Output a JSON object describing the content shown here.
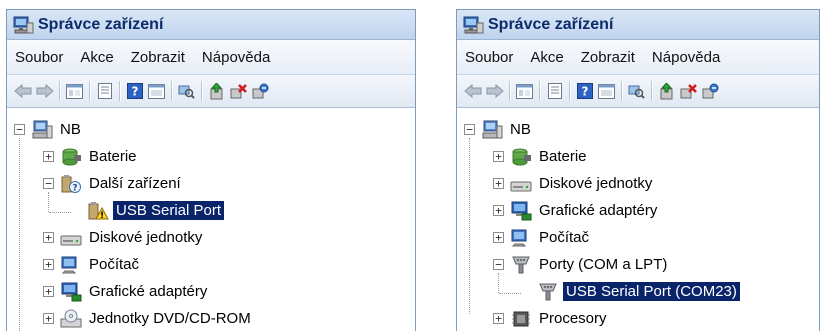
{
  "windows": [
    {
      "title": "Správce zařízení",
      "menu": [
        "Soubor",
        "Akce",
        "Zobrazit",
        "Nápověda"
      ],
      "toolbar_icons": [
        "back-arrow-icon",
        "forward-arrow-icon",
        "sep",
        "show-hide-tree-icon",
        "sep",
        "properties-icon",
        "sep",
        "help-icon",
        "view-icon",
        "sep",
        "scan-hardware-icon",
        "sep",
        "update-driver-icon",
        "uninstall-icon",
        "disable-icon"
      ],
      "tree": [
        {
          "label": "NB",
          "level": 0,
          "expander": "minus",
          "icon": "computer-icon"
        },
        {
          "label": "Baterie",
          "level": 1,
          "expander": "plus",
          "icon": "battery-icon"
        },
        {
          "label": "Další zařízení",
          "level": 1,
          "expander": "minus",
          "icon": "unknown-device-icon"
        },
        {
          "label": "USB Serial Port",
          "level": 2,
          "expander": "none",
          "icon": "warning-device-icon",
          "selected": true
        },
        {
          "label": "Diskové jednotky",
          "level": 1,
          "expander": "plus",
          "icon": "disk-drive-icon"
        },
        {
          "label": "Počítač",
          "level": 1,
          "expander": "plus",
          "icon": "computer-monitor-icon"
        },
        {
          "label": "Grafické adaptéry",
          "level": 1,
          "expander": "plus",
          "icon": "display-adapter-icon"
        },
        {
          "label": "Jednotky DVD/CD-ROM",
          "level": 1,
          "expander": "plus",
          "icon": "dvd-drive-icon"
        }
      ]
    },
    {
      "title": "Správce zařízení",
      "menu": [
        "Soubor",
        "Akce",
        "Zobrazit",
        "Nápověda"
      ],
      "toolbar_icons": [
        "back-arrow-icon",
        "forward-arrow-icon",
        "sep",
        "show-hide-tree-icon",
        "sep",
        "properties-icon",
        "sep",
        "help-icon",
        "view-icon",
        "sep",
        "scan-hardware-icon",
        "sep",
        "update-driver-icon",
        "uninstall-icon",
        "disable-icon"
      ],
      "tree": [
        {
          "label": "NB",
          "level": 0,
          "expander": "minus",
          "icon": "computer-icon"
        },
        {
          "label": "Baterie",
          "level": 1,
          "expander": "plus",
          "icon": "battery-icon"
        },
        {
          "label": "Diskové jednotky",
          "level": 1,
          "expander": "plus",
          "icon": "disk-drive-icon"
        },
        {
          "label": "Grafické adaptéry",
          "level": 1,
          "expander": "plus",
          "icon": "display-adapter-icon"
        },
        {
          "label": "Počítač",
          "level": 1,
          "expander": "plus",
          "icon": "computer-monitor-icon"
        },
        {
          "label": "Porty (COM a LPT)",
          "level": 1,
          "expander": "minus",
          "icon": "port-icon"
        },
        {
          "label": "USB Serial Port (COM23)",
          "level": 2,
          "expander": "none",
          "icon": "port-icon",
          "selected": true
        },
        {
          "label": "Procesory",
          "level": 1,
          "expander": "plus",
          "icon": "processor-icon"
        }
      ]
    }
  ],
  "colors": {
    "selection": "#0a246a",
    "title_text": "#0b2c68",
    "title_bar": "#c9dbf1"
  }
}
